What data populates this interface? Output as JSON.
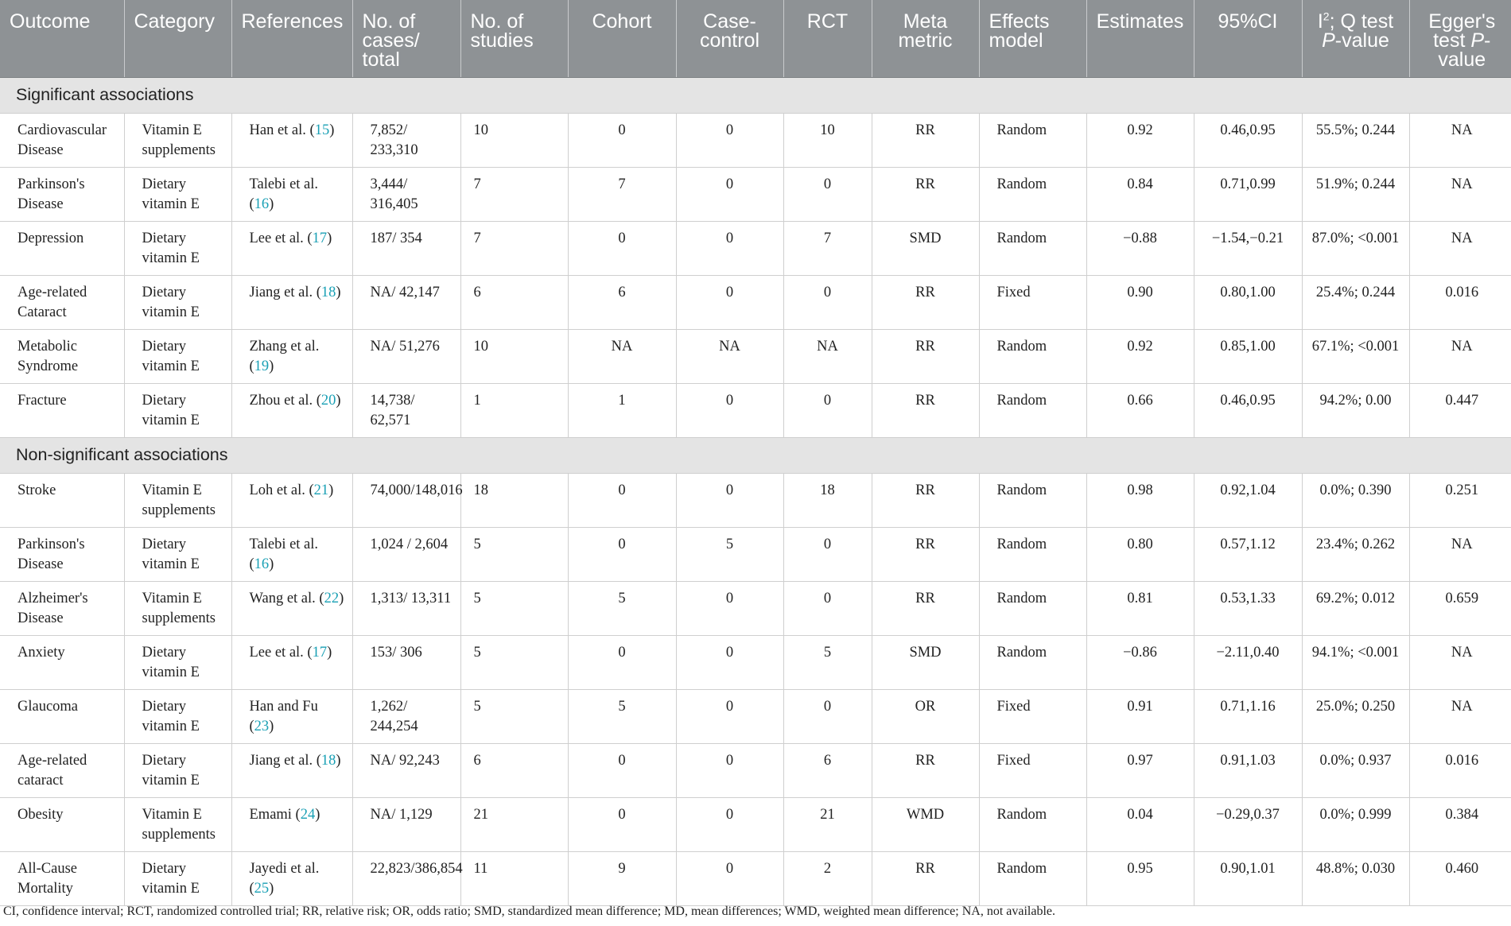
{
  "headers": {
    "outcome": "Outcome",
    "category": "Category",
    "references": "References",
    "cases_total": "No. of cases/ total",
    "studies": "No. of studies",
    "cohort": "Cohort",
    "case_control": "Case-control",
    "rct": "RCT",
    "meta_metric": "Meta metric",
    "effects_model": "Effects model",
    "estimates": "Estimates",
    "ci": "95%CI",
    "i2_pre": "I",
    "i2_sup": "2",
    "i2_post": "; Q test",
    "i2_p": "P",
    "i2_value": "-value",
    "egger_pre": "Egger's test ",
    "egger_p": "P",
    "egger_value": "-value"
  },
  "sections": [
    {
      "title": "Significant associations",
      "rows": [
        {
          "outcome": "Cardiovascular Disease",
          "category": "Vitamin E supplements",
          "ref_author": "Han et al. (",
          "ref_num": "15",
          "ref_close": ")",
          "cases": "7,852/ 233,310",
          "studies": "10",
          "cohort": "0",
          "case_control": "0",
          "rct": "10",
          "metric": "RR",
          "model": "Random",
          "estimate": "0.92",
          "ci": "0.46,0.95",
          "i2q": "55.5%; 0.244",
          "egger": "NA"
        },
        {
          "outcome": "Parkinson's Disease",
          "category": "Dietary vitamin E",
          "ref_author": "Talebi et al. (",
          "ref_num": "16",
          "ref_close": ")",
          "cases": "3,444/ 316,405",
          "studies": "7",
          "cohort": "7",
          "case_control": "0",
          "rct": "0",
          "metric": "RR",
          "model": "Random",
          "estimate": "0.84",
          "ci": "0.71,0.99",
          "i2q": "51.9%; 0.244",
          "egger": "NA"
        },
        {
          "outcome": "Depression",
          "category": "Dietary vitamin E",
          "ref_author": "Lee et al. (",
          "ref_num": "17",
          "ref_close": ")",
          "cases": "187/ 354",
          "studies": "7",
          "cohort": "0",
          "case_control": "0",
          "rct": "7",
          "metric": "SMD",
          "model": "Random",
          "estimate": "−0.88",
          "ci": "−1.54,−0.21",
          "i2q": "87.0%; <0.001",
          "egger": "NA"
        },
        {
          "outcome": "Age-related Cataract",
          "category": "Dietary vitamin E",
          "ref_author": "Jiang et al. (",
          "ref_num": "18",
          "ref_close": ")",
          "cases": "NA/ 42,147",
          "studies": "6",
          "cohort": "6",
          "case_control": "0",
          "rct": "0",
          "metric": "RR",
          "model": "Fixed",
          "estimate": "0.90",
          "ci": "0.80,1.00",
          "i2q": "25.4%; 0.244",
          "egger": "0.016"
        },
        {
          "outcome": "Metabolic Syndrome",
          "category": "Dietary vitamin E",
          "ref_author": "Zhang et al. (",
          "ref_num": "19",
          "ref_close": ")",
          "cases": "NA/ 51,276",
          "studies": "10",
          "cohort": "NA",
          "case_control": "NA",
          "rct": "NA",
          "metric": "RR",
          "model": "Random",
          "estimate": "0.92",
          "ci": "0.85,1.00",
          "i2q": "67.1%; <0.001",
          "egger": "NA"
        },
        {
          "outcome": "Fracture",
          "category": "Dietary vitamin E",
          "ref_author": "Zhou et al. (",
          "ref_num": "20",
          "ref_close": ")",
          "cases": "14,738/ 62,571",
          "studies": "1",
          "cohort": "1",
          "case_control": "0",
          "rct": "0",
          "metric": "RR",
          "model": "Random",
          "estimate": "0.66",
          "ci": "0.46,0.95",
          "i2q": "94.2%; 0.00",
          "egger": "0.447"
        }
      ]
    },
    {
      "title": "Non-significant associations",
      "rows": [
        {
          "outcome": "Stroke",
          "category": "Vitamin E supplements",
          "ref_author": "Loh et al. (",
          "ref_num": "21",
          "ref_close": ")",
          "cases": "74,000/148,016",
          "studies": "18",
          "cohort": "0",
          "case_control": "0",
          "rct": "18",
          "metric": "RR",
          "model": "Random",
          "estimate": "0.98",
          "ci": "0.92,1.04",
          "i2q": "0.0%; 0.390",
          "egger": "0.251"
        },
        {
          "outcome": "Parkinson's Disease",
          "category": "Dietary vitamin E",
          "ref_author": "Talebi et al. (",
          "ref_num": "16",
          "ref_close": ")",
          "cases": "1,024 / 2,604",
          "studies": "5",
          "cohort": "0",
          "case_control": "5",
          "rct": "0",
          "metric": "RR",
          "model": "Random",
          "estimate": "0.80",
          "ci": "0.57,1.12",
          "i2q": "23.4%; 0.262",
          "egger": "NA"
        },
        {
          "outcome": "Alzheimer's Disease",
          "category": "Vitamin E supplements",
          "ref_author": "Wang et al. (",
          "ref_num": "22",
          "ref_close": ")",
          "cases": "1,313/ 13,311",
          "studies": "5",
          "cohort": "5",
          "case_control": "0",
          "rct": "0",
          "metric": "RR",
          "model": "Random",
          "estimate": "0.81",
          "ci": "0.53,1.33",
          "i2q": "69.2%; 0.012",
          "egger": "0.659"
        },
        {
          "outcome": "Anxiety",
          "category": "Dietary vitamin E",
          "ref_author": "Lee et al. (",
          "ref_num": "17",
          "ref_close": ")",
          "cases": "153/ 306",
          "studies": "5",
          "cohort": "0",
          "case_control": "0",
          "rct": "5",
          "metric": "SMD",
          "model": "Random",
          "estimate": "−0.86",
          "ci": "−2.11,0.40",
          "i2q": "94.1%; <0.001",
          "egger": "NA"
        },
        {
          "outcome": "Glaucoma",
          "category": "Dietary vitamin E",
          "ref_author": "Han and Fu (",
          "ref_num": "23",
          "ref_close": ")",
          "cases": "1,262/ 244,254",
          "studies": "5",
          "cohort": "5",
          "case_control": "0",
          "rct": "0",
          "metric": "OR",
          "model": "Fixed",
          "estimate": "0.91",
          "ci": "0.71,1.16",
          "i2q": "25.0%; 0.250",
          "egger": "NA"
        },
        {
          "outcome": "Age-related cataract",
          "category": "Dietary vitamin E",
          "ref_author": "Jiang et al. (",
          "ref_num": "18",
          "ref_close": ")",
          "cases": "NA/ 92,243",
          "studies": "6",
          "cohort": "0",
          "case_control": "0",
          "rct": "6",
          "metric": "RR",
          "model": "Fixed",
          "estimate": "0.97",
          "ci": "0.91,1.03",
          "i2q": "0.0%; 0.937",
          "egger": "0.016"
        },
        {
          "outcome": "Obesity",
          "category": "Vitamin E supplements",
          "ref_author": "Emami (",
          "ref_num": "24",
          "ref_close": ")",
          "cases": "NA/ 1,129",
          "studies": "21",
          "cohort": "0",
          "case_control": "0",
          "rct": "21",
          "metric": "WMD",
          "model": "Random",
          "estimate": "0.04",
          "ci": "−0.29,0.37",
          "i2q": "0.0%; 0.999",
          "egger": "0.384"
        },
        {
          "outcome": "All-Cause Mortality",
          "category": "Dietary vitamin E",
          "ref_author": "Jayedi et al. (",
          "ref_num": "25",
          "ref_close": ")",
          "cases": "22,823/386,854",
          "studies": "11",
          "cohort": "9",
          "case_control": "0",
          "rct": "2",
          "metric": "RR",
          "model": "Random",
          "estimate": "0.95",
          "ci": "0.90,1.01",
          "i2q": "48.8%; 0.030",
          "egger": "0.460"
        }
      ]
    }
  ],
  "footnote": "CI, confidence interval; RCT, randomized controlled trial; RR, relative risk; OR, odds ratio; SMD, standardized mean difference; MD, mean differences; WMD, weighted mean difference; NA, not available."
}
